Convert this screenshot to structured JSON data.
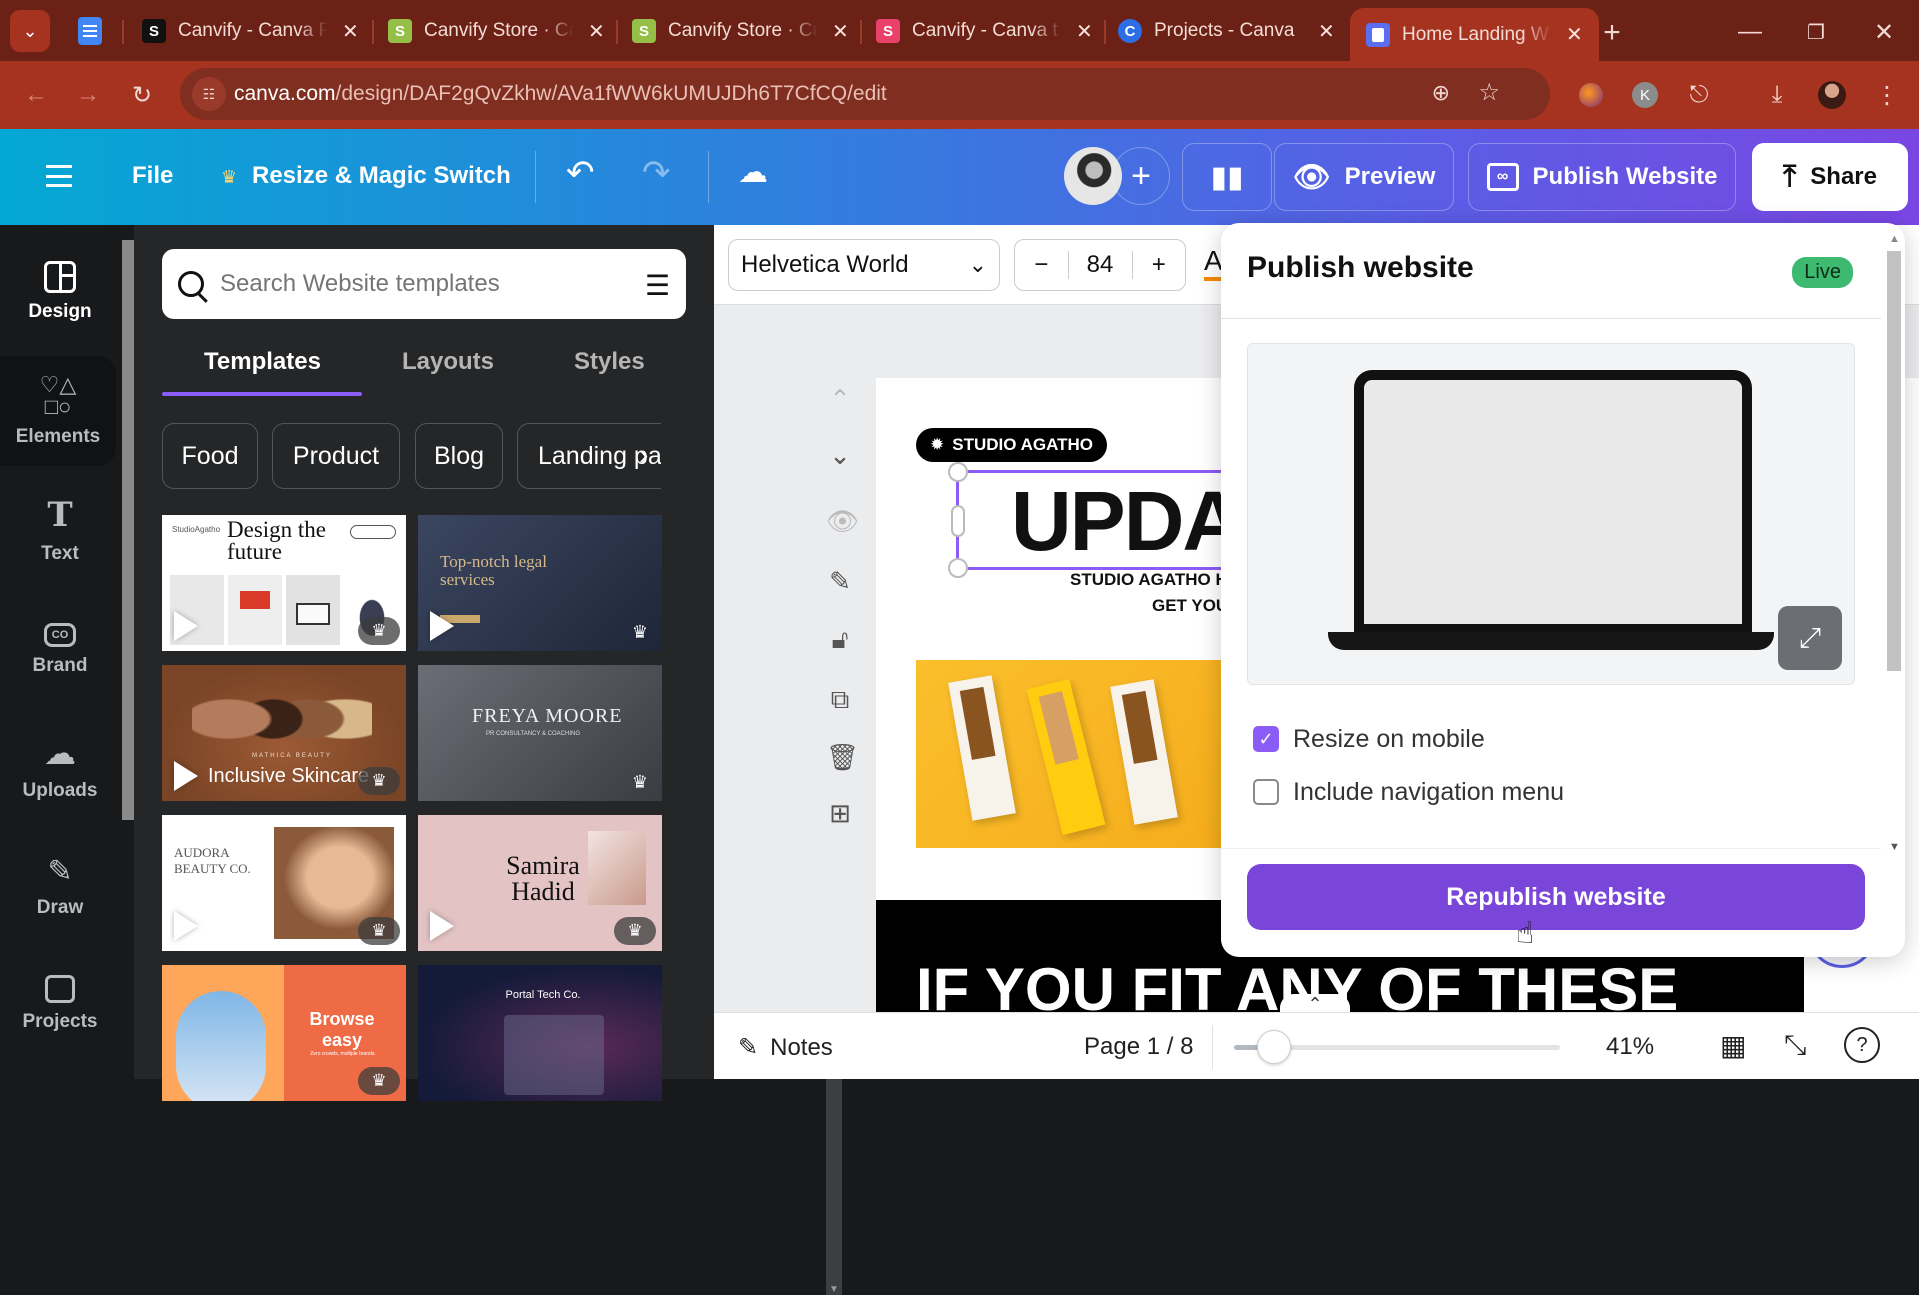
{
  "browser": {
    "tabs": [
      {
        "title": "Canvify - Canva P",
        "icon": "shopify-black-icon"
      },
      {
        "title": "Canvify Store · Ca",
        "icon": "shopify-green-icon"
      },
      {
        "title": "Canvify Store · Cu",
        "icon": "shopify-green-icon"
      },
      {
        "title": "Canvify - Canva t",
        "icon": "canvify-icon"
      },
      {
        "title": "Projects - Canva",
        "icon": "canva-icon"
      },
      {
        "title": "Home Landing W",
        "icon": "canva-website-icon",
        "active": true
      }
    ],
    "url_domain": "canva.com",
    "url_path": "/design/DAF2gQvZkhw/AVa1fWW6kUMUJDh6T7CfCQ/edit",
    "profile_initial": "K"
  },
  "header": {
    "file_label": "File",
    "resize_label": "Resize & Magic Switch",
    "preview_label": "Preview",
    "publish_label": "Publish Website",
    "share_label": "Share"
  },
  "rail": {
    "items": [
      {
        "label": "Design",
        "icon": "design-icon",
        "active": true
      },
      {
        "label": "Elements",
        "icon": "elements-icon"
      },
      {
        "label": "Text",
        "icon": "text-icon"
      },
      {
        "label": "Brand",
        "icon": "brand-icon"
      },
      {
        "label": "Uploads",
        "icon": "uploads-icon"
      },
      {
        "label": "Draw",
        "icon": "draw-icon"
      },
      {
        "label": "Projects",
        "icon": "projects-icon"
      }
    ]
  },
  "panel": {
    "search_placeholder": "Search Website templates",
    "tabs": [
      "Templates",
      "Layouts",
      "Styles"
    ],
    "active_tab": "Templates",
    "chips": [
      "Food",
      "Product",
      "Blog",
      "Landing pa"
    ],
    "templates": [
      {
        "title": "Design the future",
        "brand": "StudioAgatho",
        "premium": true,
        "video": true
      },
      {
        "title": "Top-notch legal services",
        "premium": true,
        "video": true
      },
      {
        "title": "Inclusive Skincare",
        "brand": "MATHICA BEAUTY",
        "premium": true,
        "video": true
      },
      {
        "title": "FREYA MOORE",
        "subtitle": "PR CONSULTANCY & COACHING",
        "premium": true,
        "video": false
      },
      {
        "title": "AUDORA BEAUTY CO.",
        "premium": true,
        "video": true
      },
      {
        "title": "Samira Hadid",
        "premium": true,
        "video": true
      },
      {
        "title": "Browse easy",
        "subtitle": "Zero crowds, multiple brands.",
        "premium": true,
        "video": false
      },
      {
        "title": "Portal Tech Co.",
        "premium": false,
        "video": false
      }
    ]
  },
  "texttoolbar": {
    "font": "Helvetica World",
    "font_size": "84"
  },
  "canvas": {
    "badge": "STUDIO AGATHO",
    "headline": "UPDA",
    "subline1": "STUDIO AGATHO H",
    "subline2": "GET YOU",
    "bottom_text": "IF YOU FIT ANY OF THESE"
  },
  "dialog": {
    "title": "Publish website",
    "status_badge": "Live",
    "options": [
      {
        "label": "Resize on mobile",
        "checked": true
      },
      {
        "label": "Include navigation menu",
        "checked": false
      }
    ],
    "primary_button": "Republish website"
  },
  "status": {
    "notes_label": "Notes",
    "page_indicator": "Page 1 / 8",
    "zoom_percent": 41,
    "zoom_label": "41%"
  },
  "colors": {
    "accent": "#8b5cf6",
    "primary_button": "#7a45d9",
    "live": "#3dba6f"
  }
}
